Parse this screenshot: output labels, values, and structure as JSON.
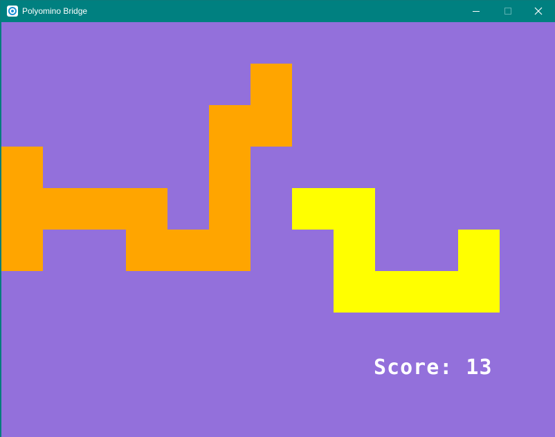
{
  "window": {
    "title": "Polyomino Bridge"
  },
  "colors": {
    "titlebar": "#008080",
    "background": "#9370db",
    "piece_orange": "#ffa500",
    "piece_yellow": "#ffff00",
    "score_text": "#ffffff"
  },
  "game": {
    "score_text": "Score: 13",
    "pieces": [
      {
        "name": "orange-piece",
        "color": "#ffa500",
        "cells": [
          [
            6,
            1
          ],
          [
            5,
            2
          ],
          [
            6,
            2
          ],
          [
            5,
            3
          ],
          [
            0,
            3
          ],
          [
            0,
            4
          ],
          [
            1,
            4
          ],
          [
            2,
            4
          ],
          [
            3,
            4
          ],
          [
            5,
            4
          ],
          [
            0,
            5
          ],
          [
            3,
            5
          ],
          [
            4,
            5
          ],
          [
            5,
            5
          ]
        ]
      },
      {
        "name": "yellow-piece",
        "color": "#ffff00",
        "cells": [
          [
            7,
            4
          ],
          [
            8,
            4
          ],
          [
            8,
            5
          ],
          [
            11,
            5
          ],
          [
            8,
            6
          ],
          [
            9,
            6
          ],
          [
            10,
            6
          ],
          [
            11,
            6
          ]
        ]
      }
    ]
  }
}
